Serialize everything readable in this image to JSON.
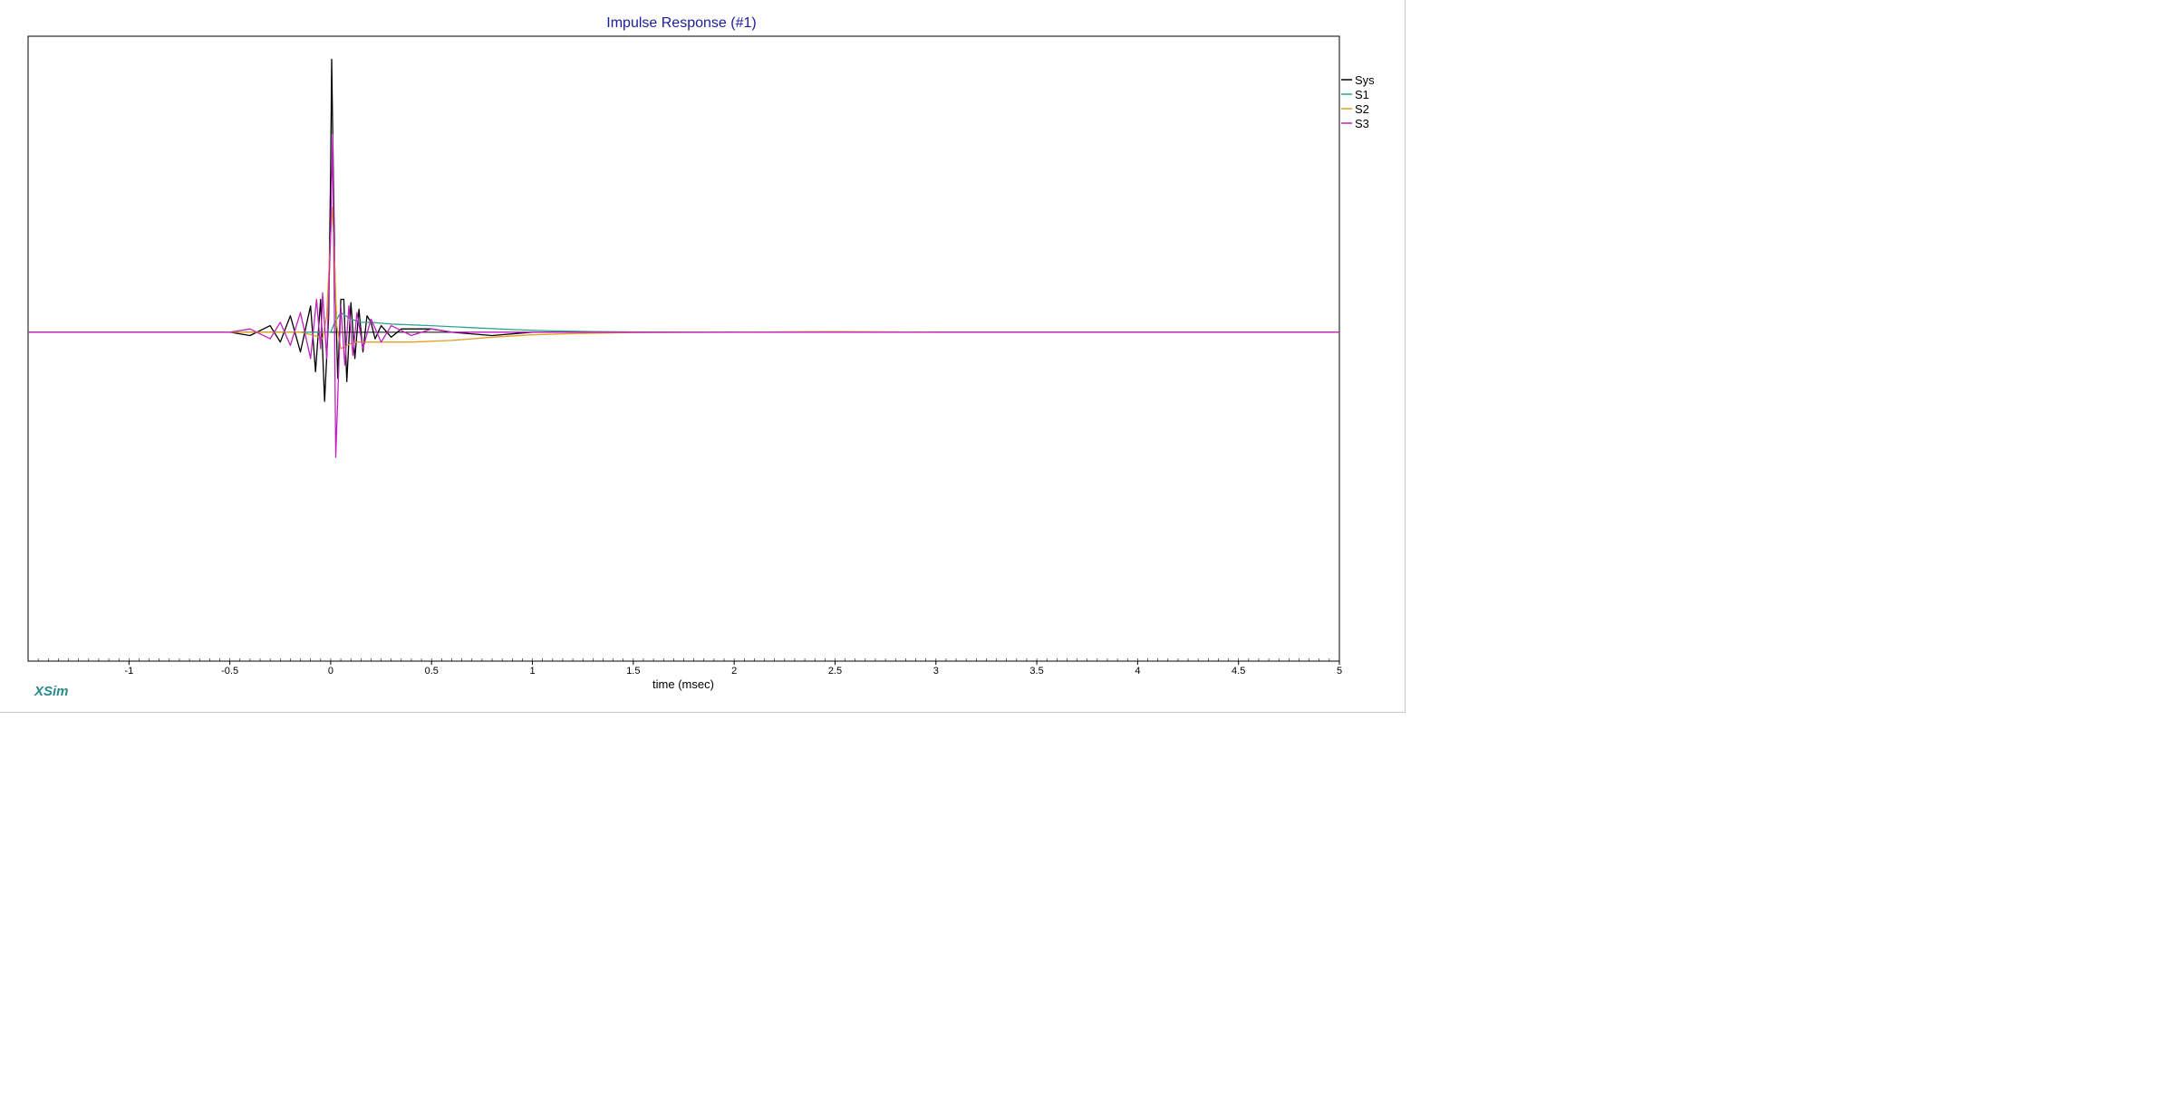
{
  "chart_data": {
    "type": "line",
    "title": "Impulse Response (#1)",
    "xlabel": "time (msec)",
    "ylabel": "",
    "xlim": [
      -1.5,
      5
    ],
    "ylim": [
      -1.0,
      0.9
    ],
    "x_ticks": [
      -1,
      -0.5,
      0,
      0.5,
      1,
      1.5,
      2,
      2.5,
      3,
      3.5,
      4,
      4.5,
      5
    ],
    "x_tick_labels": [
      "-1",
      "-0.5",
      "0",
      "0.5",
      "1",
      "1.5",
      "2",
      "2.5",
      "3",
      "3.5",
      "4",
      "4.5",
      "5"
    ],
    "grid": false,
    "legend_position": "top-right, outside plot",
    "series": [
      {
        "name": "Sys",
        "color": "#000000",
        "x": [
          -1.5,
          -0.5,
          -0.4,
          -0.3,
          -0.25,
          -0.2,
          -0.15,
          -0.1,
          -0.075,
          -0.05,
          -0.03,
          -0.01,
          0.0,
          0.005,
          0.01,
          0.02,
          0.035,
          0.05,
          0.065,
          0.08,
          0.1,
          0.12,
          0.14,
          0.16,
          0.18,
          0.2,
          0.22,
          0.25,
          0.3,
          0.35,
          0.4,
          0.5,
          0.6,
          0.8,
          1.0,
          1.2,
          1.5,
          2.0,
          3.0,
          4.0,
          5.0
        ],
        "y": [
          0.0,
          0.0,
          -0.01,
          0.02,
          -0.03,
          0.05,
          -0.06,
          0.08,
          -0.12,
          0.1,
          -0.21,
          0.05,
          0.5,
          0.83,
          0.62,
          0.2,
          -0.14,
          0.1,
          0.1,
          -0.15,
          0.09,
          -0.08,
          0.07,
          -0.06,
          0.05,
          0.03,
          -0.02,
          0.02,
          -0.015,
          0.01,
          0.01,
          0.01,
          0.0,
          -0.01,
          0.0,
          0.0,
          0.0,
          0.0,
          0.0,
          0.0,
          0.0
        ]
      },
      {
        "name": "S1",
        "color": "#2ca58d",
        "x": [
          -1.5,
          -0.2,
          -0.1,
          -0.05,
          -0.02,
          0.0,
          0.02,
          0.05,
          0.1,
          0.15,
          0.2,
          0.3,
          0.5,
          0.7,
          0.9,
          1.1,
          1.3,
          1.5,
          2.0,
          3.0,
          5.0
        ],
        "y": [
          0.0,
          0.0,
          0.0,
          0.0,
          0.0,
          0.0,
          0.03,
          0.06,
          0.04,
          0.03,
          0.03,
          0.025,
          0.02,
          0.014,
          0.008,
          0.004,
          0.002,
          0.001,
          0.0,
          0.0,
          0.0
        ]
      },
      {
        "name": "S2",
        "color": "#e0a020",
        "x": [
          -1.5,
          -0.3,
          -0.15,
          -0.08,
          -0.04,
          -0.02,
          0.0,
          0.01,
          0.02,
          0.03,
          0.05,
          0.08,
          0.12,
          0.2,
          0.3,
          0.4,
          0.6,
          0.8,
          1.0,
          1.2,
          1.5,
          2.0,
          2.5,
          3.0,
          5.0
        ],
        "y": [
          0.0,
          0.0,
          0.0,
          -0.01,
          -0.02,
          0.05,
          0.3,
          0.38,
          0.2,
          0.02,
          -0.05,
          -0.04,
          -0.03,
          -0.03,
          -0.03,
          -0.03,
          -0.025,
          -0.015,
          -0.008,
          -0.004,
          -0.001,
          0.0,
          0.002,
          0.0,
          0.0
        ]
      },
      {
        "name": "S3",
        "color": "#c020c0",
        "x": [
          -1.5,
          -0.5,
          -0.4,
          -0.3,
          -0.25,
          -0.2,
          -0.15,
          -0.1,
          -0.07,
          -0.05,
          -0.04,
          -0.02,
          0.0,
          0.01,
          0.02,
          0.025,
          0.035,
          0.05,
          0.07,
          0.09,
          0.11,
          0.13,
          0.16,
          0.2,
          0.25,
          0.3,
          0.4,
          0.5,
          0.6,
          0.8,
          1.0,
          1.5,
          2.0,
          3.0,
          4.0,
          4.5,
          5.0
        ],
        "y": [
          0.0,
          0.0,
          0.01,
          -0.02,
          0.03,
          -0.04,
          0.06,
          -0.08,
          0.1,
          -0.05,
          0.12,
          -0.08,
          0.3,
          0.6,
          -0.05,
          -0.38,
          -0.2,
          0.08,
          -0.1,
          0.08,
          -0.07,
          0.06,
          -0.05,
          0.04,
          -0.03,
          0.02,
          -0.01,
          0.01,
          0.0,
          0.0,
          0.0,
          0.0,
          0.0,
          0.0,
          0.0,
          0.0,
          0.0
        ]
      }
    ]
  },
  "branding": {
    "logo_text": "XSim"
  }
}
